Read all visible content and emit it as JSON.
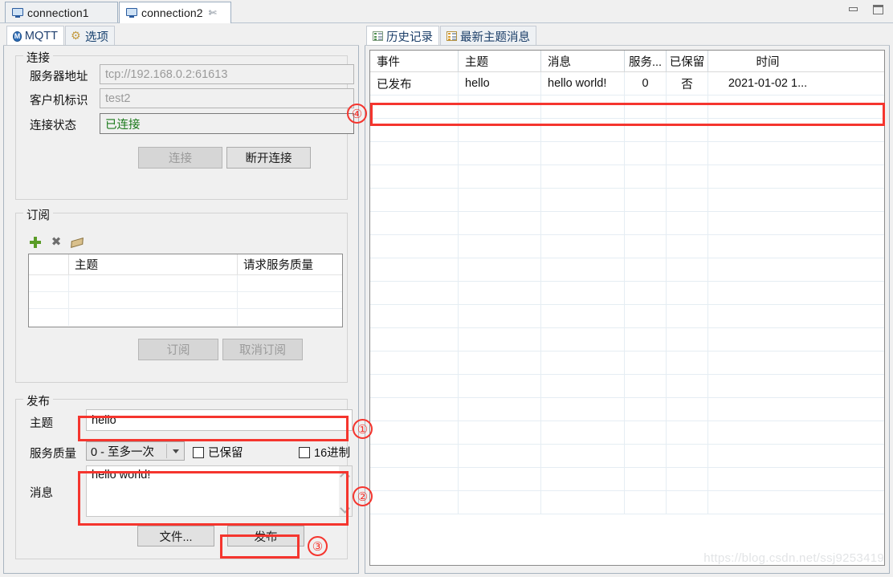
{
  "window": {
    "tabs": [
      {
        "label": "connection1",
        "icon": "monitor-icon",
        "active": false,
        "closable": false
      },
      {
        "label": "connection2",
        "icon": "monitor-icon",
        "active": true,
        "closable": true,
        "close_glyph": "✄"
      }
    ],
    "controls": {
      "minimize": "minimize-icon",
      "maximize": "maximize-icon"
    }
  },
  "left_panel": {
    "tabs": [
      {
        "label": "MQTT",
        "icon": "mqtt-icon",
        "icon_glyph": "M",
        "active": true
      },
      {
        "label": "选项",
        "icon": "gear-icon",
        "active": false
      }
    ],
    "connection": {
      "group_title": "连接",
      "fields": [
        {
          "label": "服务器地址",
          "value": "tcp://192.168.0.2:61613"
        },
        {
          "label": "客户机标识",
          "value": "test2"
        },
        {
          "label": "连接状态",
          "value": "已连接",
          "value_color": "#1b7a1b"
        }
      ],
      "buttons": [
        {
          "label": "连接",
          "enabled": false
        },
        {
          "label": "断开连接",
          "enabled": true
        }
      ]
    },
    "subscribe": {
      "group_title": "订阅",
      "toolbar": [
        {
          "name": "add-subscription-icon",
          "glyph": "+"
        },
        {
          "name": "delete-subscription-icon",
          "glyph": "✖"
        },
        {
          "name": "clear-subscription-icon",
          "glyph": ""
        }
      ],
      "columns": [
        "",
        "主题",
        "请求服务质量"
      ],
      "rows": [],
      "buttons": [
        {
          "label": "订阅",
          "enabled": false
        },
        {
          "label": "取消订阅",
          "enabled": false
        }
      ]
    },
    "publish": {
      "group_title": "发布",
      "topic_label": "主题",
      "topic_value": "hello",
      "qos_label": "服务质量",
      "qos_value": "0 - 至多一次",
      "retained_label": "已保留",
      "retained_checked": false,
      "hex_label": "16进制",
      "hex_checked": false,
      "message_label": "消息",
      "message_value": "hello world!",
      "buttons": [
        {
          "label": "文件...",
          "enabled": true
        },
        {
          "label": "发布",
          "enabled": true
        }
      ]
    }
  },
  "right_panel": {
    "tabs": [
      {
        "label": "历史记录",
        "icon": "history-list-icon",
        "active": true
      },
      {
        "label": "最新主题消息",
        "icon": "latest-message-icon",
        "active": false
      }
    ],
    "table": {
      "columns": [
        "事件",
        "主题",
        "消息",
        "服务...",
        "已保留",
        "时间"
      ],
      "rows": [
        {
          "event": "已发布",
          "topic": "hello",
          "message": "hello world!",
          "qos": "0",
          "retained": "否",
          "time": "2021-01-02 1..."
        }
      ],
      "empty_row_count": 18
    }
  },
  "annotations": {
    "color": "#f5352e",
    "markers": [
      {
        "id": "1",
        "label": "①",
        "target": "publish-topic-input"
      },
      {
        "id": "2",
        "label": "②",
        "target": "publish-message-textarea"
      },
      {
        "id": "3",
        "label": "③",
        "target": "publish-button"
      },
      {
        "id": "4",
        "label": "④",
        "target": "history-first-row"
      }
    ]
  },
  "watermark": {
    "text": "https://blog.csdn.net/ssj9253419"
  }
}
